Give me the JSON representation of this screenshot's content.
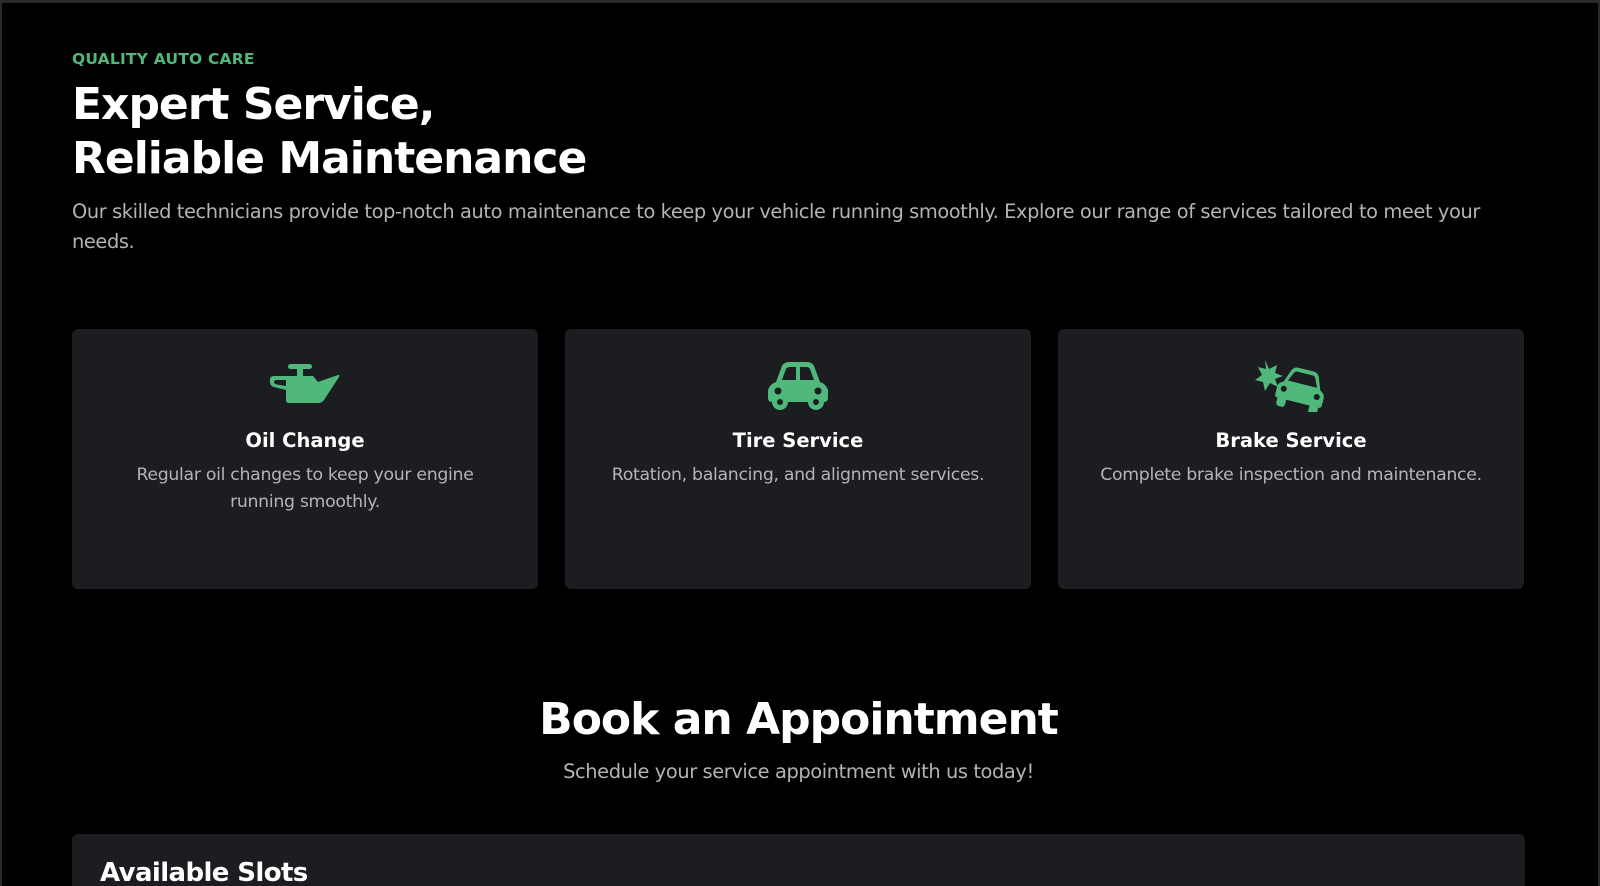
{
  "hero": {
    "eyebrow": "QUALITY AUTO CARE",
    "title_line1": "Expert Service,",
    "title_line2": "Reliable Maintenance",
    "description": "Our skilled technicians provide top-notch auto maintenance to keep your vehicle running smoothly. Explore our range of services tailored to meet your needs."
  },
  "services": [
    {
      "icon": "oil-can-icon",
      "title": "Oil Change",
      "description": "Regular oil changes to keep your engine running smoothly."
    },
    {
      "icon": "car-icon",
      "title": "Tire Service",
      "description": "Rotation, balancing, and alignment services."
    },
    {
      "icon": "car-crash-icon",
      "title": "Brake Service",
      "description": "Complete brake inspection and maintenance."
    }
  ],
  "booking": {
    "title": "Book an Appointment",
    "subtitle": "Schedule your service appointment with us today!",
    "slots_title": "Available Slots"
  },
  "colors": {
    "accent": "#4fb87a",
    "background": "#000000",
    "card": "#1c1d21",
    "muted_text": "#b4b4b8"
  }
}
